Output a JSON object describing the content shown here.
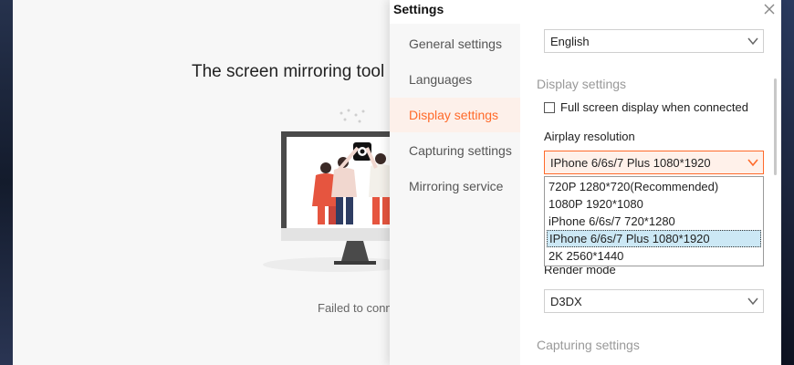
{
  "background_app": {
    "title": "The screen mirroring tool",
    "status": "Failed to conne"
  },
  "settings": {
    "title": "Settings",
    "close_icon": "close-icon",
    "nav": [
      {
        "label": "General settings",
        "active": false
      },
      {
        "label": "Languages",
        "active": false
      },
      {
        "label": "Display settings",
        "active": true
      },
      {
        "label": "Capturing settings",
        "active": false
      },
      {
        "label": "Mirroring service",
        "active": false
      }
    ],
    "language": {
      "value": "English"
    },
    "display_section": "Display settings",
    "fullscreen_checkbox": {
      "label": "Full screen display when connected",
      "checked": false
    },
    "airplay_resolution": {
      "label": "Airplay resolution",
      "value": "IPhone 6/6s/7 Plus 1080*1920",
      "options": [
        "720P 1280*720(Recommended)",
        "1080P 1920*1080",
        "iPhone 6/6s/7 720*1280",
        "IPhone 6/6s/7 Plus 1080*1920",
        "2K 2560*1440"
      ],
      "selected_index": 3
    },
    "render_mode": {
      "label": "Render mode",
      "value": "D3DX"
    },
    "capturing_section": "Capturing settings"
  },
  "colors": {
    "accent": "#ff6a2a",
    "active_nav_bg": "#fdf0ea",
    "selected_option_bg": "#cce8f5"
  }
}
